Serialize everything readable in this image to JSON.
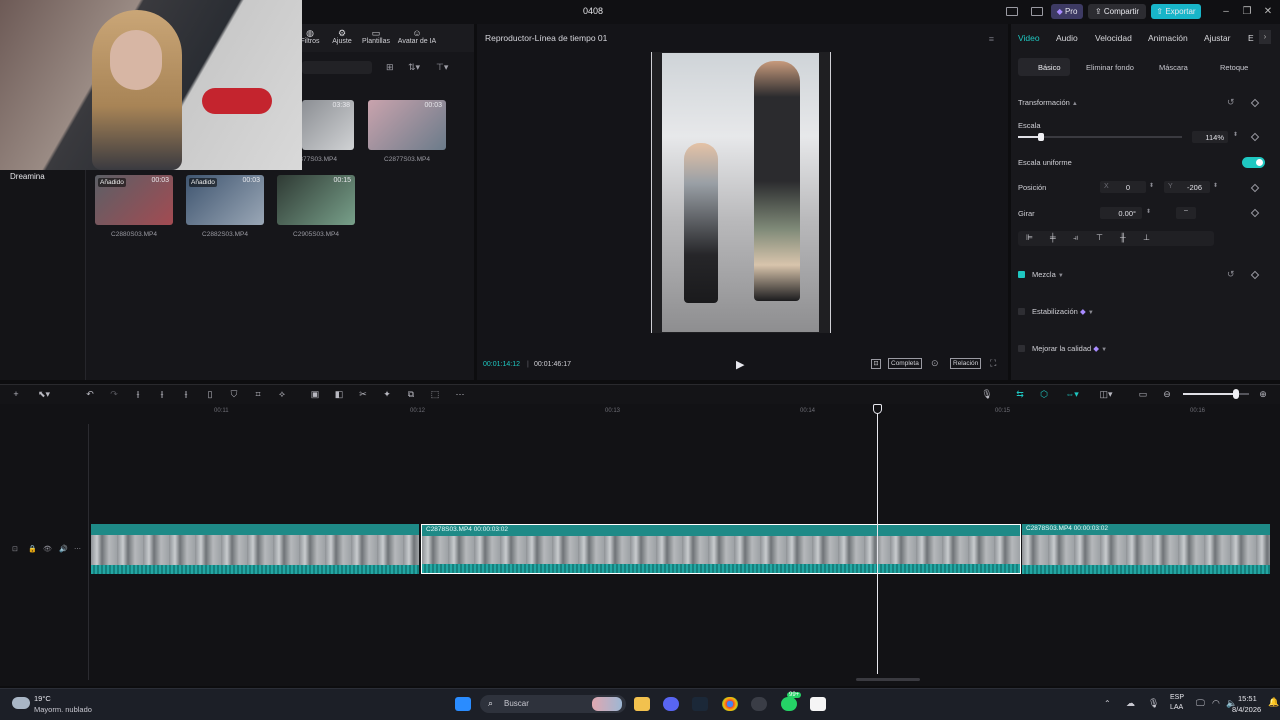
{
  "window": {
    "title": "0408",
    "pro_label": "Pro",
    "share_label": "Compartir",
    "export_label": "Exportar"
  },
  "media": {
    "tabs": [
      "Filtros",
      "Ajuste",
      "Plantillas",
      "Avatar de IA"
    ],
    "sidebar_item": "Dreamina",
    "items": [
      {
        "name": "C2877S03.MP4",
        "duration": "03:38",
        "added": ""
      },
      {
        "name": "C2877S03.MP4",
        "duration": "00:03",
        "added": ""
      },
      {
        "name": "C2880S03.MP4",
        "duration": "00:03",
        "added": "Añadido"
      },
      {
        "name": "C2882S03.MP4",
        "duration": "00:03",
        "added": "Añadido"
      },
      {
        "name": "C2905S03.MP4",
        "duration": "00:15",
        "added": ""
      }
    ]
  },
  "player": {
    "title": "Reproductor-Línea de tiempo 01",
    "current_time": "00:01:14:12",
    "total_time": "00:01:46:17",
    "complete_label": "Completa",
    "ratio_label": "Relación"
  },
  "inspector": {
    "tabs": [
      "Video",
      "Audio",
      "Velocidad",
      "Animación",
      "Ajustar",
      "E"
    ],
    "subtabs": [
      "Básico",
      "Eliminar fondo",
      "Máscara",
      "Retoque"
    ],
    "transform_label": "Transformación",
    "scale_label": "Escala",
    "scale_value": "114%",
    "scale_fraction": 0.14,
    "uniform_label": "Escala uniforme",
    "position_label": "Posición",
    "pos_x_label": "X",
    "pos_x": "0",
    "pos_y_label": "Y",
    "pos_y": "-206",
    "rotate_label": "Girar",
    "rotate_value": "0.00°",
    "rotate_dash": "–",
    "blend_label": "Mezcla",
    "stabilize_label": "Estabilización",
    "quality_label": "Mejorar la calidad"
  },
  "timeline": {
    "ruler": [
      "00:11",
      "00:12",
      "00:13",
      "00:14",
      "00:15",
      "00:16"
    ],
    "clips": [
      {
        "label": ""
      },
      {
        "label": "C2878S03.MP4   00:00:03:02"
      },
      {
        "label": "C2878S03.MP4   00:00:03:02"
      }
    ],
    "zoom_fraction": 0.8
  },
  "taskbar": {
    "temperature": "19°C",
    "weather": "Mayorm. nublado",
    "search_placeholder": "Buscar",
    "lang_top": "ESP",
    "lang_bottom": "LAA",
    "time": "15:51",
    "date": "8/4/2026",
    "badge": "99+"
  },
  "colors": {
    "accent": "#1fc7c1",
    "export": "#18b5c9",
    "clip": "#1e8a87",
    "pro": "#3d3a63"
  }
}
